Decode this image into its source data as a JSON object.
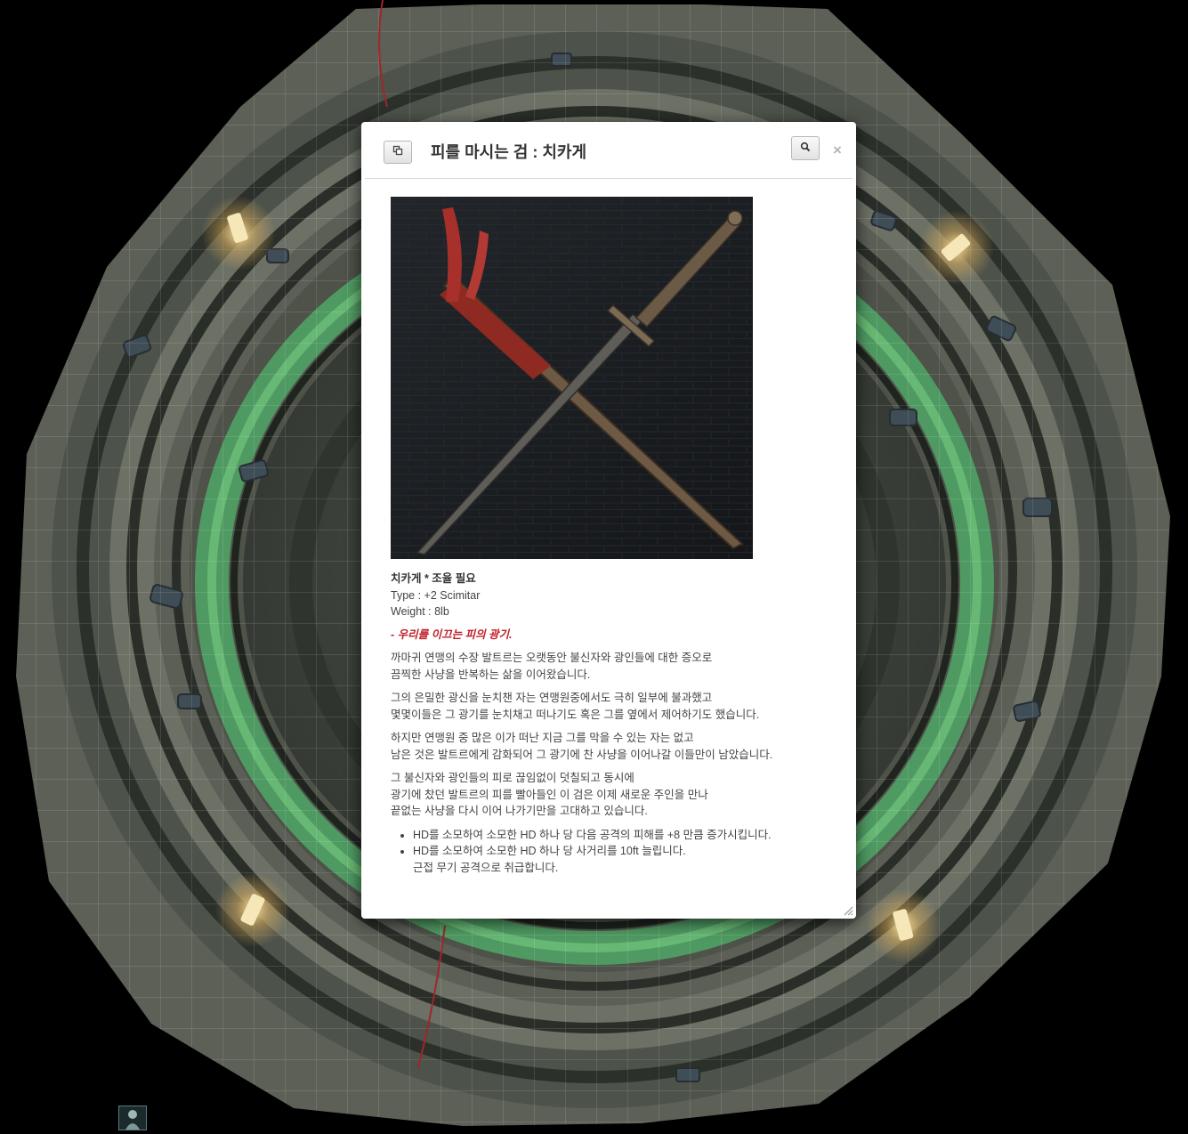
{
  "colors": {
    "page_background": "#000000",
    "dialog_background": "#ffffff",
    "flavor_text": "#c0202a",
    "body_text": "#444444",
    "map_stone": "#5a5e54",
    "map_glow_ring": "#4f9a62"
  },
  "dialog": {
    "title": "피를 마시는 검 : 치카게",
    "popout_icon": "popout-icon",
    "search_icon": "search-icon",
    "close_label": "×",
    "image_alt": "치카게 검 이미지",
    "item_name": "치카게 * 조율 필요",
    "type_line": "Type : +2 Scimitar",
    "weight_line": "Weight : 8lb",
    "flavor": "- 우리를 이끄는 피의 광기.",
    "paragraphs": [
      {
        "line1": "까마귀 연맹의 수장 발트르는 오랫동안 불신자와 광인들에 대한 증오로",
        "line2": "끔찍한 사냥을 반복하는 삶을 이어왔습니다."
      },
      {
        "line1": "그의 은밀한 광신을 눈치챈 자는 연맹원중에서도 극히 일부에 불과했고",
        "line2": "몇몇이들은 그 광기를 눈치채고 떠나기도 혹은 그를 옆에서 제어하기도 했습니다."
      },
      {
        "line1": "하지만 연맹원 중 많은 이가 떠난 지금 그를 막을 수 있는 자는 없고",
        "line2": "남은 것은 발트르에게 감화되어 그 광기에 찬 사냥을 이어나갈 이들만이 남았습니다."
      }
    ],
    "last_paragraph": {
      "line1": "그 불신자와 광인들의 피로 끊임없이 덧칠되고 동시에",
      "line2": "광기에 찼던 발트르의 피를 빨아들인 이 검은 이제 새로운 주인을 만나",
      "line3": "끝없는 사냥을 다시 이어 나가기만을 고대하고 있습니다."
    },
    "features": {
      "item1": "HD를 소모하여 소모한 HD 하나 당 다음 공격의 피해를 +8 만큼 증가시킵니다.",
      "item2_line1": "HD를 소모하여 소모한 HD 하나 당 사거리를 10ft 늘립니다.",
      "item2_line2": "근접 무기 공격으로 취급합니다."
    }
  },
  "map": {
    "candles": [
      "candle-icon",
      "candle-icon",
      "candle-icon",
      "candle-icon"
    ],
    "token_icon": "character-token-icon"
  }
}
